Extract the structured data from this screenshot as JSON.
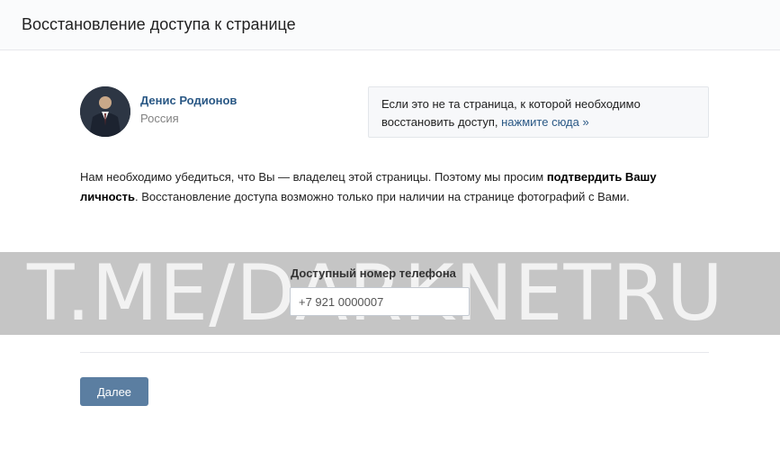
{
  "header": {
    "title": "Восстановление доступа к странице"
  },
  "user": {
    "name": "Денис Родионов",
    "country": "Россия"
  },
  "notice": {
    "text": "Если это не та страница, к которой необходимо восстановить доступ, ",
    "link": "нажмите сюда »"
  },
  "description": {
    "part1": "Нам необходимо убедиться, что Вы — владелец этой страницы. Поэтому мы просим ",
    "bold": "подтвердить Вашу личность",
    "part2": ". Восстановление доступа возможно только при наличии на странице фотографий с Вами."
  },
  "phone": {
    "label": "Доступный номер телефона",
    "value": "+7 921 0000007"
  },
  "buttons": {
    "next": "Далее"
  },
  "watermark": {
    "text": "T.ME/DARKNETRU"
  },
  "colors": {
    "link": "#2a5885",
    "button": "#5b7ea1"
  }
}
